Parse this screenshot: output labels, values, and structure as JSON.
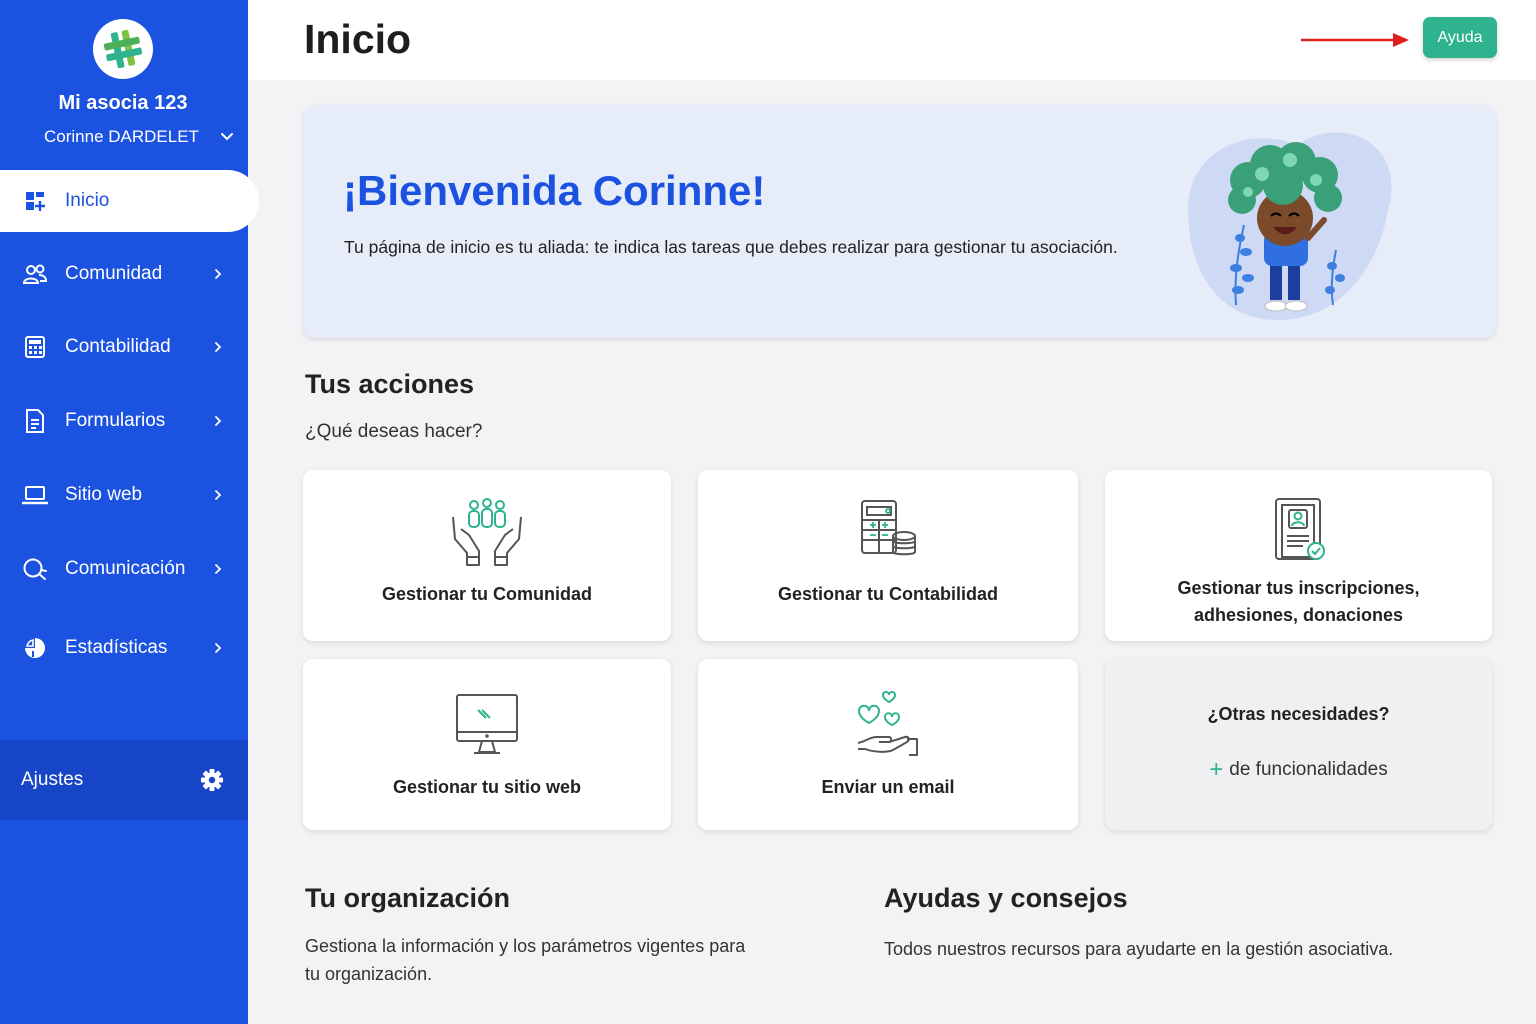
{
  "sidebar": {
    "org_name": "Mi asocia 123",
    "user_name": "Corinne DARDELET",
    "items": [
      {
        "label": "Inicio",
        "icon": "dashboard-icon",
        "active": true
      },
      {
        "label": "Comunidad",
        "icon": "users-icon"
      },
      {
        "label": "Contabilidad",
        "icon": "calculator-icon"
      },
      {
        "label": "Formularios",
        "icon": "document-icon"
      },
      {
        "label": "Sitio web",
        "icon": "laptop-icon"
      },
      {
        "label": "Comunicación",
        "icon": "chat-icon"
      },
      {
        "label": "Estadísticas",
        "icon": "pie-chart-icon"
      }
    ],
    "settings_label": "Ajustes"
  },
  "header": {
    "title": "Inicio",
    "help_label": "Ayuda"
  },
  "banner": {
    "title": "¡Bienvenida Corinne!",
    "text": "Tu página de inicio es tu aliada: te indica las tareas que debes realizar para gestionar tu asociación."
  },
  "actions": {
    "title": "Tus acciones",
    "subtitle": "¿Qué deseas hacer?",
    "cards": [
      {
        "label": "Gestionar tu Comunidad",
        "icon": "community-hands-icon"
      },
      {
        "label": "Gestionar tu Contabilidad",
        "icon": "accounting-icon"
      },
      {
        "label": "Gestionar tus inscripciones, adhesiones, donaciones",
        "icon": "registration-form-icon"
      },
      {
        "label": "Gestionar tu sitio web",
        "icon": "monitor-icon"
      },
      {
        "label": "Enviar un email",
        "icon": "hand-hearts-icon"
      }
    ],
    "other": {
      "title": "¿Otras necesidades?",
      "link": "de funcionalidades"
    }
  },
  "organization": {
    "title": "Tu organización",
    "text": "Gestiona la información y los parámetros vigentes para tu organización."
  },
  "tips": {
    "title": "Ayudas y consejos",
    "text": "Todos nuestros recursos para ayudarte en la gestión asociativa."
  },
  "colors": {
    "sidebar": "#1c52e0",
    "accent_green": "#2fb38f",
    "banner_bg": "#e7ecf9",
    "arrow_red": "#e02020"
  }
}
